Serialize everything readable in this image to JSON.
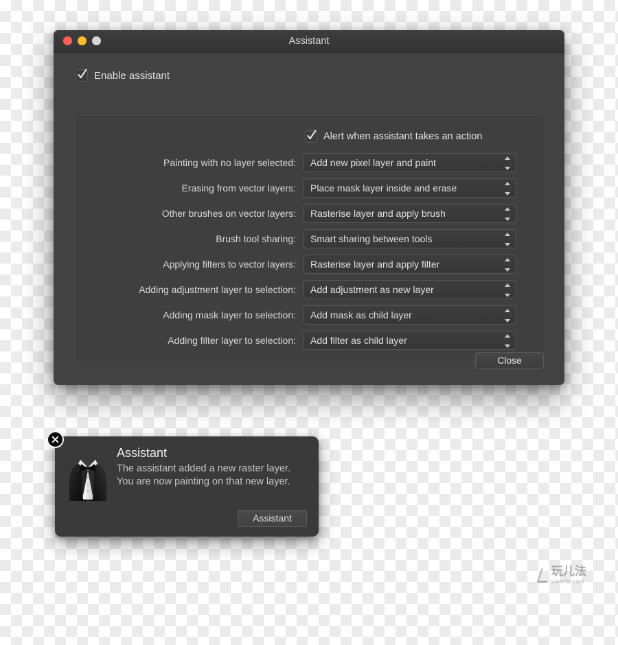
{
  "window": {
    "title": "Assistant",
    "traffic_lights": [
      {
        "name": "close",
        "color": "#fc5f57"
      },
      {
        "name": "minimize",
        "color": "#fdbc2e"
      },
      {
        "name": "zoom",
        "color": "#d6d6d6"
      }
    ],
    "enable_checkbox": {
      "label": "Enable assistant",
      "checked": true
    },
    "alert_checkbox": {
      "label": "Alert when assistant takes an action",
      "checked": true
    },
    "rows": [
      {
        "label": "Painting with no layer selected:",
        "value": "Add new pixel layer and paint"
      },
      {
        "label": "Erasing from vector layers:",
        "value": "Place mask layer inside and erase"
      },
      {
        "label": "Other brushes on vector layers:",
        "value": "Rasterise layer and apply brush"
      },
      {
        "label": "Brush tool sharing:",
        "value": "Smart sharing between tools"
      },
      {
        "label": "Applying filters to vector layers:",
        "value": "Rasterise layer and apply filter"
      },
      {
        "label": "Adding adjustment layer to selection:",
        "value": "Add adjustment as new layer"
      },
      {
        "label": "Adding mask layer to selection:",
        "value": "Add mask as child layer"
      },
      {
        "label": "Adding filter layer to selection:",
        "value": "Add filter as child layer"
      }
    ],
    "close_button": "Close"
  },
  "notification": {
    "title": "Assistant",
    "lines": [
      "The assistant added a new raster layer.",
      "You are now painting on that new layer."
    ],
    "action_button": "Assistant",
    "icon": "tuxedo-icon",
    "close_icon": "close-icon"
  },
  "watermark": {
    "text_cn": "玩儿法",
    "url": "waerfa.com"
  },
  "colors": {
    "window_body": "#424242",
    "titlebar": "#383838",
    "panel": "#3f3f3f",
    "field": "#3a3a3a",
    "text": "#e0e0e0",
    "notification": "#3a3a3a"
  }
}
